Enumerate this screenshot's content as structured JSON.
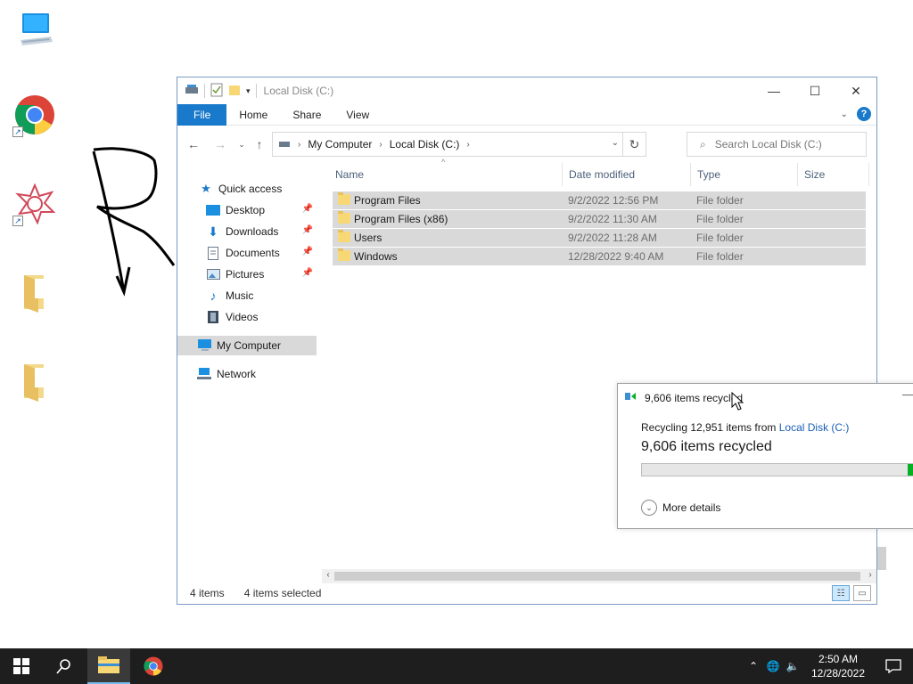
{
  "desktop": {
    "icons": [
      "computer-icon",
      "chrome-icon",
      "app-icon",
      "folder-icon",
      "folder-icon"
    ]
  },
  "window": {
    "title": "Local Disk (C:)",
    "ribbon": {
      "file": "File",
      "home": "Home",
      "share": "Share",
      "view": "View"
    },
    "address": {
      "crumbs": [
        "My Computer",
        "Local Disk (C:)"
      ]
    },
    "search": {
      "placeholder": "Search Local Disk (C:)"
    },
    "nav": {
      "items": [
        {
          "label": "Quick access"
        },
        {
          "label": "Desktop"
        },
        {
          "label": "Downloads"
        },
        {
          "label": "Documents"
        },
        {
          "label": "Pictures"
        },
        {
          "label": "Music"
        },
        {
          "label": "Videos"
        },
        {
          "label": "My Computer"
        },
        {
          "label": "Network"
        }
      ]
    },
    "columns": {
      "name": "Name",
      "date": "Date modified",
      "type": "Type",
      "size": "Size"
    },
    "files": [
      {
        "name": "Program Files",
        "date": "9/2/2022 12:56 PM",
        "type": "File folder"
      },
      {
        "name": "Program Files (x86)",
        "date": "9/2/2022 11:30 AM",
        "type": "File folder"
      },
      {
        "name": "Users",
        "date": "9/2/2022 11:28 AM",
        "type": "File folder"
      },
      {
        "name": "Windows",
        "date": "12/28/2022 9:40 AM",
        "type": "File folder"
      }
    ],
    "status": {
      "count": "4 items",
      "selected": "4 items selected"
    }
  },
  "dialog": {
    "title": "9,606 items recycled",
    "line1_prefix": "Recycling 12,951 items from ",
    "line1_link": "Local Disk (C:)",
    "line2": "9,606 items recycled",
    "progress": 0.02,
    "more": "More details"
  },
  "taskbar": {
    "time": "2:50 AM",
    "date": "12/28/2022"
  },
  "colors": {
    "accent": "#1979ca",
    "progress": "#06b025",
    "selection": "#d9d9d9"
  }
}
